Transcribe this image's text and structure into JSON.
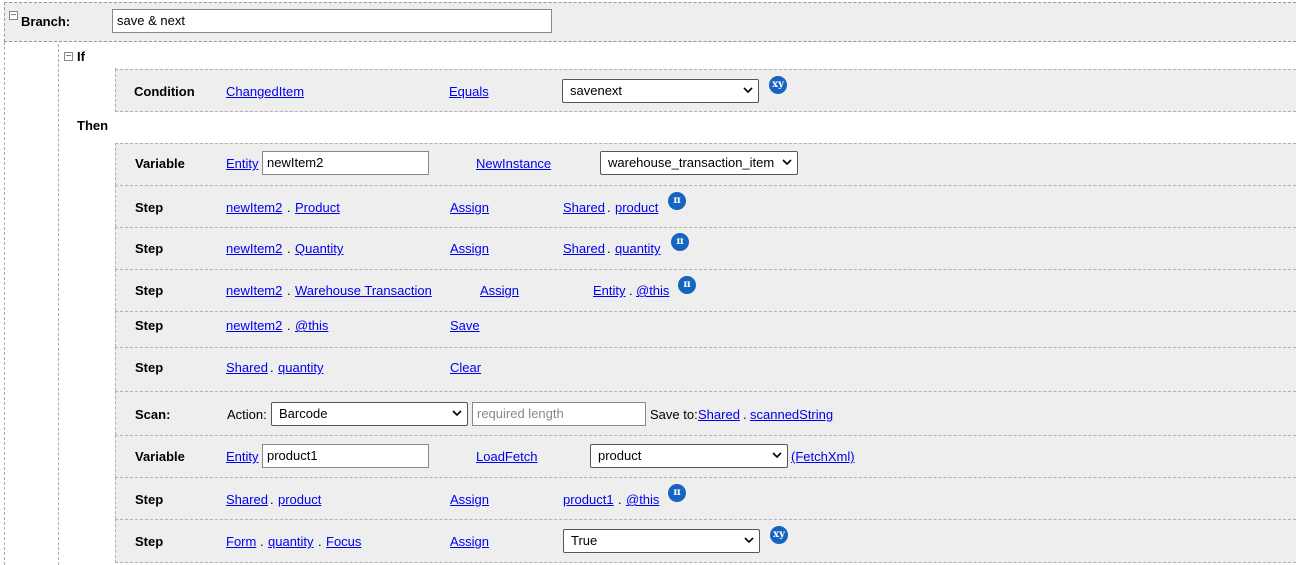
{
  "branch": {
    "label": "Branch:",
    "value": "save & next"
  },
  "if_label": "If",
  "then_label": "Then",
  "condition": {
    "label": "Condition",
    "field": "ChangedItem",
    "operator": "Equals",
    "value": "savenext",
    "badge": "xy"
  },
  "variable1": {
    "label": "Variable",
    "type": "Entity",
    "name": "newItem2",
    "method": "NewInstance",
    "value": "warehouse_transaction_item"
  },
  "steps": [
    {
      "label": "Step",
      "left": [
        "newItem2",
        "Product"
      ],
      "op": "Assign",
      "right": [
        "Shared",
        "product"
      ],
      "badge": "π"
    },
    {
      "label": "Step",
      "left": [
        "newItem2",
        "Quantity"
      ],
      "op": "Assign",
      "right": [
        "Shared",
        "quantity"
      ],
      "badge": "π"
    },
    {
      "label": "Step",
      "left": [
        "newItem2",
        "Warehouse Transaction"
      ],
      "op": "Assign",
      "right": [
        "Entity",
        "@this"
      ],
      "badge": "π"
    },
    {
      "label": "Step",
      "left": [
        "newItem2",
        "@this"
      ],
      "op": "Save"
    },
    {
      "label": "Step",
      "left": [
        "Shared",
        "quantity"
      ],
      "op": "Clear"
    }
  ],
  "scan": {
    "label": "Scan:",
    "action_label": "Action:",
    "action_value": "Barcode",
    "length_placeholder": "required length",
    "save_to_label": "Save to:",
    "save_to": [
      "Shared",
      "scannedString"
    ]
  },
  "variable2": {
    "label": "Variable",
    "type": "Entity",
    "name": "product1",
    "method": "LoadFetch",
    "value": "product",
    "extra": "(FetchXml)"
  },
  "steps2": [
    {
      "label": "Step",
      "left": [
        "Shared",
        "product"
      ],
      "op": "Assign",
      "right": [
        "product1",
        "@this"
      ],
      "badge": "π"
    },
    {
      "label": "Step",
      "left": [
        "Form",
        "quantity",
        "Focus"
      ],
      "op": "Assign",
      "value": "True",
      "badge": "xy"
    }
  ],
  "separator": "."
}
